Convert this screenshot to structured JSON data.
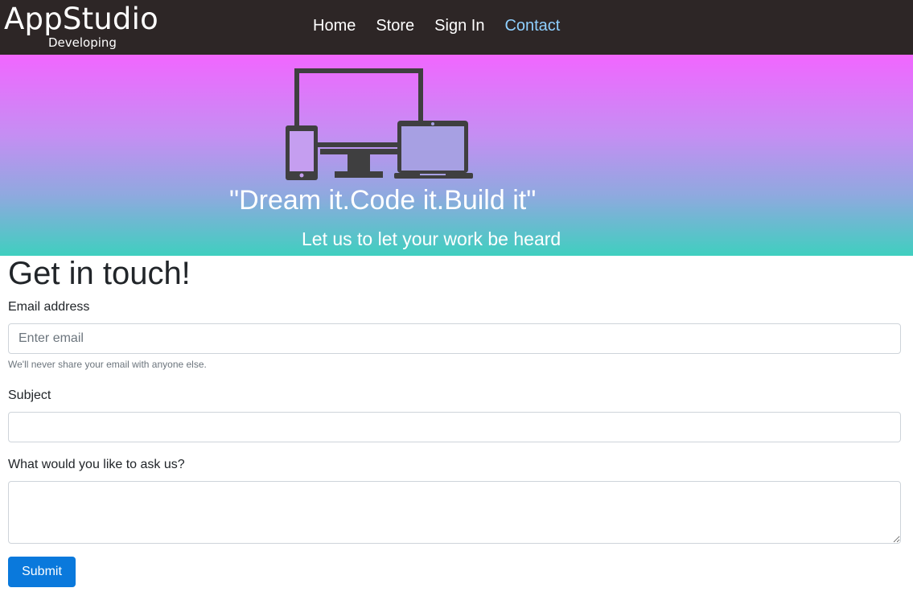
{
  "nav": {
    "brand_title": "AppStudio",
    "brand_subtitle": "Developing",
    "links": [
      {
        "label": "Home"
      },
      {
        "label": "Store"
      },
      {
        "label": "Sign In"
      },
      {
        "label": "Contact",
        "active": true
      }
    ]
  },
  "hero": {
    "illustration_icon": "devices-icon",
    "title": "\"Dream it.Code it.Build it\"",
    "subtitle": "Let us to let your work be heard"
  },
  "form": {
    "heading": "Get in touch!",
    "email": {
      "label": "Email address",
      "placeholder": "Enter email",
      "value": "",
      "help": "We'll never share your email with anyone else."
    },
    "subject": {
      "label": "Subject",
      "value": ""
    },
    "message": {
      "label": "What would you like to ask us?",
      "value": ""
    },
    "submit_label": "Submit"
  },
  "colors": {
    "navbar": "#2d2626",
    "active_link": "#8fd0ff",
    "hero_top": "#f166ff",
    "hero_bottom": "#3fcfbf",
    "button": "#0a79dc"
  }
}
